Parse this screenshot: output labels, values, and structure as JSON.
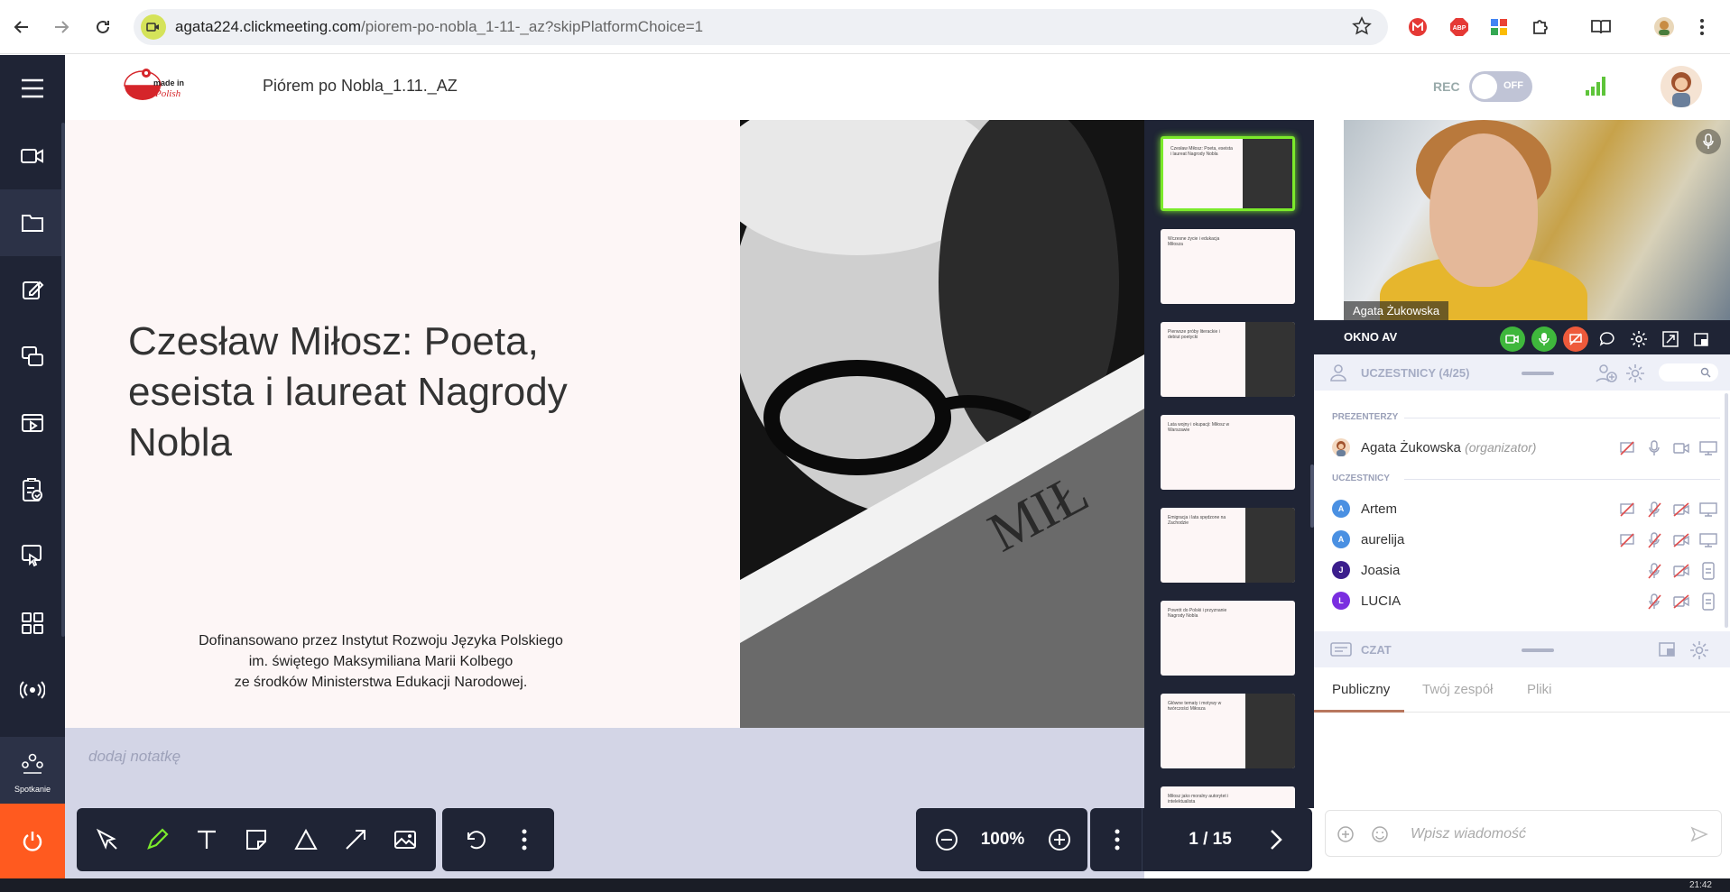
{
  "browser": {
    "url_host": "agata224.clickmeeting.com",
    "url_path": "/piorem-po-nobla_1-11-_az?skipPlatformChoice=1"
  },
  "header": {
    "logo_text": "made in Polish",
    "event_title": "Piórem po Nobla_1.11._AZ",
    "rec_label": "REC",
    "rec_state": "OFF"
  },
  "sidebar": {
    "meeting_label": "Spotkanie"
  },
  "slide": {
    "title": "Czesław Miłosz: Poeta, eseista i laureat Nagrody Nobla",
    "credit_lines": [
      "Dofinansowano przez Instytut Rozwoju Języka Polskiego",
      "im. świętego Maksymiliana Marii Kolbego",
      "ze środków Ministerstwa Edukacji Narodowej."
    ]
  },
  "notes": {
    "placeholder": "dodaj notatkę"
  },
  "toolbar": {
    "zoom": "100%",
    "page": "1 / 15"
  },
  "thumbnails": [
    {
      "title": "Czesław Miłosz: Poeta, eseista i laureat Nagrody Nobla",
      "active": true,
      "photo": true
    },
    {
      "title": "Wczesne życie i edukacja Miłosza",
      "active": false,
      "photo": false
    },
    {
      "title": "Pierwsze próby literackie i debiut poetycki",
      "active": false,
      "photo": true
    },
    {
      "title": "Lata wojny i okupacji: Miłosz w Warszawie",
      "active": false,
      "photo": false
    },
    {
      "title": "Emigracja i lata spędzone na Zachodzie",
      "active": false,
      "photo": true
    },
    {
      "title": "Powrót do Polski i przyznanie Nagrody Nobla",
      "active": false,
      "photo": false
    },
    {
      "title": "Główne tematy i motywy w twórczości Miłosza",
      "active": false,
      "photo": true
    },
    {
      "title": "Miłosz jako moralny autorytet i intelektualista",
      "active": false,
      "photo": false
    }
  ],
  "video": {
    "name": "Agata Żukowska",
    "window_label": "OKNO AV"
  },
  "participants": {
    "header": "UCZESTNICY (4/25)",
    "presenters_label": "PREZENTERZY",
    "participants_label": "UCZESTNICY",
    "presenters": [
      {
        "name": "Agata Żukowska",
        "role": "(organizator)"
      }
    ],
    "list": [
      {
        "initial": "A",
        "name": "Artem",
        "color": "#4a90e2"
      },
      {
        "initial": "A",
        "name": "aurelija",
        "color": "#4a90e2"
      },
      {
        "initial": "J",
        "name": "Joasia",
        "color": "#3b1e8c"
      },
      {
        "initial": "L",
        "name": "LUCIA",
        "color": "#7a2ee0"
      }
    ]
  },
  "chat": {
    "header": "CZAT",
    "tabs": [
      "Publiczny",
      "Twój zespół",
      "Pliki"
    ],
    "input_placeholder": "Wpisz wiadomość"
  },
  "taskbar": {
    "time": "21:42"
  },
  "colors": {
    "sidebar_bg": "#1f2435",
    "accent_orange": "#ff5a1f",
    "active_green": "#7bea2b",
    "muted_red": "#e04b4b"
  }
}
